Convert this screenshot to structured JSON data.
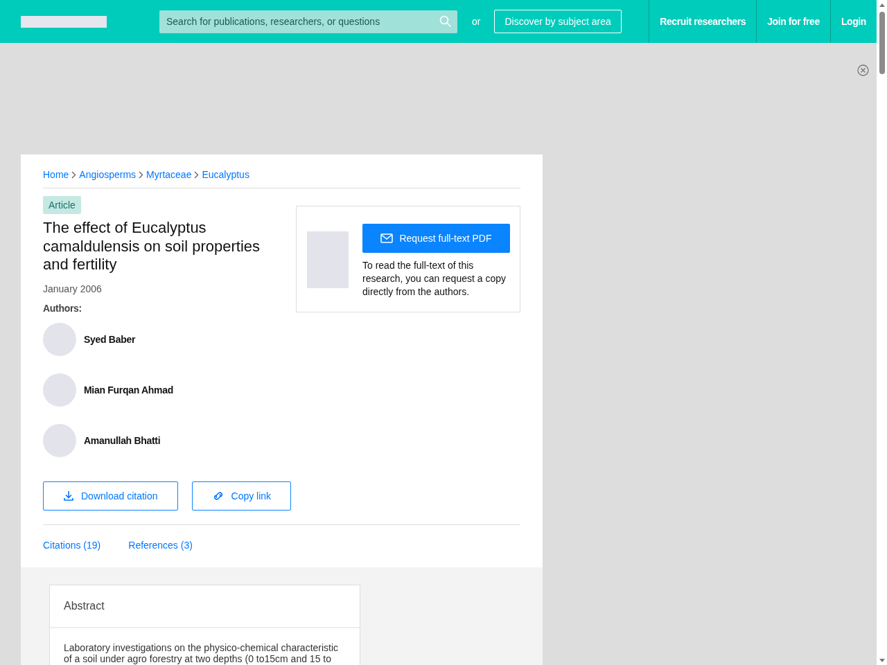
{
  "header": {
    "search": {
      "placeholder": "Search for publications, researchers, or questions"
    },
    "or_text": "or",
    "discover_button": "Discover by subject area",
    "nav": [
      "Recruit researchers",
      "Join for free",
      "Login"
    ]
  },
  "breadcrumb": [
    "Home",
    "Angiosperms",
    "Myrtaceae",
    "Eucalyptus"
  ],
  "article": {
    "type_badge": "Article",
    "title": "The effect of Eucalyptus camaldulensis on soil properties and fertility",
    "date": "January 2006",
    "authors_label": "Authors:",
    "authors": [
      {
        "name": "Syed Baber"
      },
      {
        "name": "Mian Furqan Ahmad"
      },
      {
        "name": "Amanullah Bhatti"
      }
    ],
    "request_button": "Request full-text PDF",
    "request_note": "To read the full-text of this research, you can request a copy directly from the authors.",
    "actions": [
      {
        "kind": "download",
        "label": "Download citation"
      },
      {
        "kind": "link",
        "label": "Copy link"
      }
    ],
    "tabs": [
      {
        "label": "Citations (19)",
        "selected": false
      },
      {
        "label": "References (3)",
        "selected": false
      }
    ]
  },
  "abstract": {
    "heading": "Abstract",
    "text": "Laboratory investigations on the physico-chemical characteristic of a soil under agro forestry at two depths (0 to15cm and 15 to"
  }
}
